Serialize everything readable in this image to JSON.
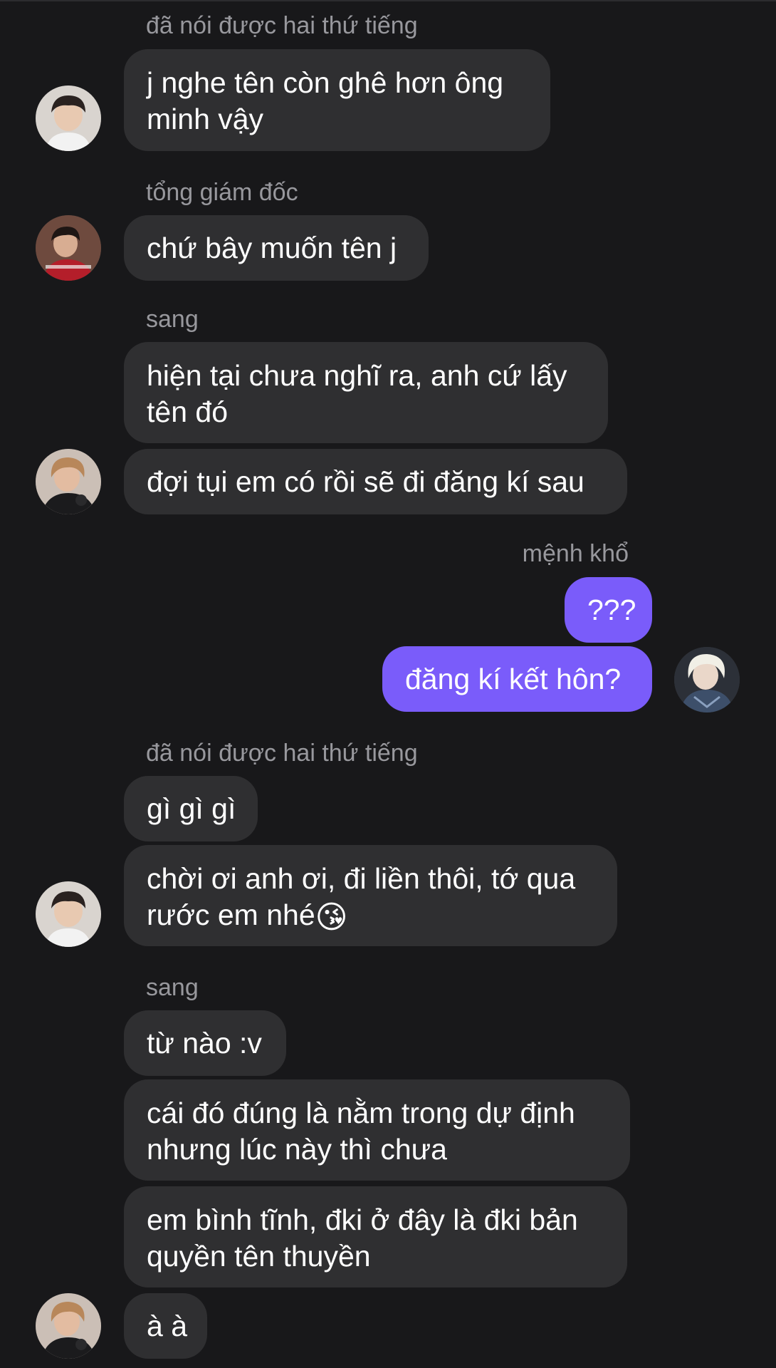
{
  "messages": [
    {
      "sender": "đã nói được hai thứ tiếng"
    },
    {
      "text": "j nghe tên còn ghê hơn ông\nminh vậy"
    },
    {
      "sender": "tổng giám đốc"
    },
    {
      "text": "chứ bây muốn tên j"
    },
    {
      "sender": "sang"
    },
    {
      "text": "hiện tại chưa nghĩ ra, anh cứ lấy\ntên đó"
    },
    {
      "text": "đợi tụi em có rồi sẽ đi đăng kí sau"
    },
    {
      "sender": "mệnh khổ"
    },
    {
      "text": "???"
    },
    {
      "text": "đăng kí kết hôn?"
    },
    {
      "sender": "đã nói được hai thứ tiếng"
    },
    {
      "text": "gì gì gì"
    },
    {
      "text": "chời ơi anh ơi, đi liền thôi, tớ qua\nrước em nhé",
      "emoji": "😘"
    },
    {
      "sender": "sang"
    },
    {
      "text": "từ nào :v"
    },
    {
      "text": "cái đó đúng là nằm trong dự định\nnhưng lúc này thì chưa"
    },
    {
      "text": "em bình tĩnh, đki ở đây là đki bản\nquyền tên thuyền"
    },
    {
      "text": "à à"
    }
  ],
  "avatars": [
    {
      "icon": "user-avatar-icon"
    },
    {
      "icon": "user-avatar-icon"
    },
    {
      "icon": "user-avatar-icon"
    },
    {
      "icon": "user-avatar-icon"
    },
    {
      "icon": "user-avatar-icon"
    },
    {
      "icon": "user-avatar-icon"
    }
  ],
  "colors": {
    "background": "#18181a",
    "incoming_bubble": "#2f2f31",
    "outgoing_bubble": "#7a5cfa",
    "sender_name": "#98989d",
    "text": "#ffffff"
  }
}
